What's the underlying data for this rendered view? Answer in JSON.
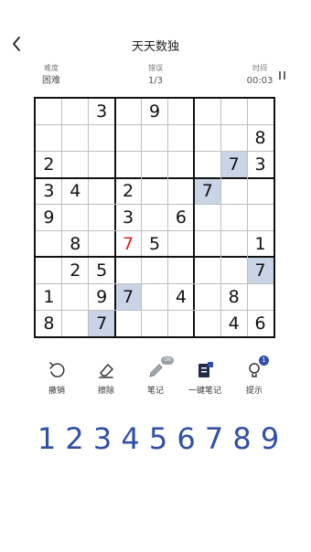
{
  "header": {
    "title": "天天数独"
  },
  "info": {
    "difficulty_label": "难度",
    "difficulty_value": "困难",
    "mistakes_label": "错误",
    "mistakes_value": "1/3",
    "time_label": "时间",
    "time_value": "00:03"
  },
  "board": {
    "cells": [
      [
        "",
        "",
        "3",
        "",
        "9",
        "",
        "",
        "",
        ""
      ],
      [
        "",
        "",
        "",
        "",
        "",
        "",
        "",
        "",
        "8"
      ],
      [
        "2",
        "",
        "",
        "",
        "",
        "",
        "",
        "7",
        "3"
      ],
      [
        "3",
        "4",
        "",
        "2",
        "",
        "",
        "7",
        "",
        ""
      ],
      [
        "9",
        "",
        "",
        "3",
        "",
        "6",
        "",
        "",
        ""
      ],
      [
        "",
        "8",
        "",
        "7",
        "5",
        "",
        "",
        "",
        "1"
      ],
      [
        "",
        "2",
        "5",
        "",
        "",
        "",
        "",
        "",
        "7"
      ],
      [
        "1",
        "",
        "9",
        "7",
        "",
        "4",
        "",
        "8",
        ""
      ],
      [
        "8",
        "",
        "7",
        "",
        "",
        "",
        "",
        "4",
        "6"
      ]
    ],
    "highlighted": [
      [
        2,
        7
      ],
      [
        3,
        6
      ],
      [
        6,
        8
      ],
      [
        7,
        3
      ],
      [
        8,
        2
      ]
    ],
    "errors": [
      [
        5,
        3
      ]
    ],
    "colors": {
      "highlight": "#c9d5e6",
      "error": "#e02020",
      "number": "#2f4fa8"
    }
  },
  "tools": [
    {
      "label": "撤销",
      "icon": "undo-icon"
    },
    {
      "label": "擦除",
      "icon": "eraser-icon"
    },
    {
      "label": "笔记",
      "icon": "pencil-icon",
      "badge": "ON"
    },
    {
      "label": "一键笔记",
      "icon": "quick-notes-icon"
    },
    {
      "label": "提示",
      "icon": "hint-bulb-icon",
      "badge": "1"
    }
  ],
  "numpad": [
    "1",
    "2",
    "3",
    "4",
    "5",
    "6",
    "7",
    "8",
    "9"
  ]
}
